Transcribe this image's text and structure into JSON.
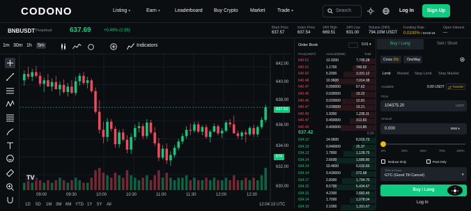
{
  "header": {
    "logo": "CODONO",
    "nav": [
      {
        "label": "Listing",
        "dropdown": true
      },
      {
        "label": "Earn",
        "dropdown": true
      },
      {
        "label": "Leaderboard",
        "dropdown": false
      },
      {
        "label": "Buy Crypto",
        "dropdown": false
      },
      {
        "label": "Market",
        "dropdown": false
      },
      {
        "label": "Trade",
        "dropdown": true
      }
    ],
    "search_placeholder": "Search",
    "login": "Log In",
    "signup": "Sign Up"
  },
  "ticker": {
    "symbol": "BNBUSDT",
    "type": "Perpetual",
    "price": "637.69",
    "change": "+0.40% (2.55)",
    "stats": [
      {
        "label": "Mark Price",
        "value": "637.57"
      },
      {
        "label": "Index Price",
        "value": "637.54"
      },
      {
        "label": "24H High",
        "value": "669.51"
      },
      {
        "label": "24H Low",
        "value": "631.00"
      },
      {
        "label": "Volume (24H)",
        "value": "794.10M USDT"
      },
      {
        "label": "Funding Rate",
        "value": "0.0100%",
        "extra": "/ 04:02:18"
      },
      {
        "label": "Open Interest",
        "value": "---"
      }
    ]
  },
  "chart_toolbar": {
    "timeframes": [
      "1m",
      "30m",
      "1h",
      "5m"
    ],
    "active_timeframe": "5m",
    "indicators": "Indicators"
  },
  "chart": {
    "price_labels": [
      "642.00",
      "640.00",
      "638.00",
      "636.00",
      "634.00",
      "632.00",
      "630.00"
    ],
    "time_labels": [
      "09:00",
      "09:30",
      "10:00",
      "10:30",
      "11:00",
      "11:30",
      "12:00",
      "12:30"
    ],
    "last_price_tag": "637.53",
    "volume_tag": "874",
    "ranges": [
      "1D",
      "5D",
      "1M",
      "3M",
      "6M",
      "YTD",
      "1Y",
      "5Y",
      "All"
    ],
    "clock": "12:04:13 UTC",
    "watermark": "TV"
  },
  "chart_data": {
    "type": "candlestick",
    "ylim": [
      630,
      643
    ],
    "candles": [
      [
        640.5,
        641.6,
        639.9,
        641.2
      ],
      [
        641.2,
        642.0,
        640.6,
        640.9
      ],
      [
        640.9,
        641.8,
        640.4,
        641.4
      ],
      [
        641.4,
        642.1,
        640.8,
        641.0
      ],
      [
        641.0,
        641.4,
        639.8,
        640.1
      ],
      [
        640.1,
        640.8,
        639.2,
        640.5
      ],
      [
        640.5,
        641.2,
        639.9,
        639.8
      ],
      [
        639.8,
        640.7,
        639.3,
        640.3
      ],
      [
        640.3,
        641.0,
        639.6,
        639.5
      ],
      [
        639.5,
        640.4,
        638.8,
        640.0
      ],
      [
        640.0,
        640.6,
        639.0,
        639.2
      ],
      [
        639.2,
        640.2,
        638.7,
        639.8
      ],
      [
        639.8,
        640.5,
        639.0,
        639.1
      ],
      [
        639.1,
        640.9,
        638.8,
        640.4
      ],
      [
        640.4,
        641.3,
        639.9,
        641.0
      ],
      [
        641.0,
        641.4,
        640.0,
        640.2
      ],
      [
        640.2,
        640.9,
        639.6,
        640.5
      ],
      [
        640.5,
        640.7,
        639.1,
        639.3
      ],
      [
        639.3,
        639.7,
        636.8,
        637.0
      ],
      [
        637.0,
        638.3,
        634.6,
        635.0
      ],
      [
        635.0,
        635.9,
        633.5,
        634.2
      ],
      [
        634.2,
        636.3,
        633.7,
        635.9
      ],
      [
        635.9,
        636.2,
        634.8,
        635.1
      ],
      [
        635.1,
        635.4,
        633.0,
        633.4
      ],
      [
        633.4,
        635.0,
        633.0,
        634.7
      ],
      [
        634.7,
        635.1,
        633.7,
        633.9
      ],
      [
        633.9,
        634.4,
        632.4,
        632.8
      ],
      [
        632.8,
        634.6,
        632.3,
        634.2
      ],
      [
        634.2,
        635.6,
        633.8,
        635.2
      ],
      [
        635.2,
        635.9,
        634.7,
        635.4
      ],
      [
        635.4,
        635.7,
        634.0,
        634.3
      ],
      [
        634.3,
        636.2,
        634.0,
        635.8
      ],
      [
        635.8,
        636.1,
        634.5,
        634.7
      ],
      [
        634.7,
        635.3,
        633.2,
        633.5
      ],
      [
        633.5,
        634.1,
        631.5,
        631.9
      ],
      [
        631.9,
        633.3,
        631.7,
        632.9
      ],
      [
        632.9,
        633.5,
        631.2,
        631.6
      ],
      [
        631.6,
        632.6,
        631.0,
        632.2
      ],
      [
        632.2,
        633.3,
        631.9,
        633.0
      ],
      [
        633.0,
        634.0,
        632.7,
        633.7
      ],
      [
        633.7,
        634.6,
        633.4,
        634.3
      ],
      [
        634.3,
        635.4,
        634.0,
        635.0
      ],
      [
        635.0,
        635.7,
        634.4,
        634.9
      ],
      [
        634.9,
        635.9,
        634.7,
        635.6
      ],
      [
        635.6,
        635.9,
        634.6,
        634.8
      ],
      [
        634.8,
        635.5,
        634.4,
        635.3
      ],
      [
        635.3,
        635.6,
        634.0,
        634.2
      ],
      [
        634.2,
        635.0,
        633.6,
        634.8
      ],
      [
        634.8,
        635.7,
        634.7,
        635.4
      ],
      [
        635.4,
        635.6,
        634.4,
        634.6
      ],
      [
        634.6,
        635.2,
        634.1,
        634.9
      ],
      [
        634.9,
        636.0,
        634.7,
        635.8
      ],
      [
        635.8,
        636.2,
        635.3,
        635.6
      ],
      [
        635.6,
        636.6,
        634.8,
        634.6
      ],
      [
        634.6,
        634.9,
        634.0,
        634.3
      ],
      [
        634.3,
        634.9,
        633.9,
        634.7
      ],
      [
        634.7,
        635.0,
        633.6,
        634.5
      ],
      [
        634.5,
        635.4,
        634.3,
        635.2
      ],
      [
        635.2,
        635.6,
        634.2,
        634.5
      ],
      [
        634.5,
        635.5,
        634.2,
        635.3
      ],
      [
        635.3,
        636.4,
        635.1,
        636.1
      ],
      [
        636.1,
        637.8,
        635.8,
        637.5
      ]
    ],
    "volumes": [
      3,
      4,
      3,
      5,
      4,
      3,
      4,
      3,
      4,
      5,
      4,
      3,
      4,
      5,
      4,
      3,
      3,
      5,
      8,
      9,
      7,
      6,
      5,
      7,
      6,
      5,
      8,
      6,
      5,
      4,
      5,
      6,
      4,
      6,
      8,
      5,
      7,
      5,
      4,
      5,
      5,
      6,
      4,
      5,
      4,
      4,
      5,
      4,
      5,
      4,
      4,
      5,
      4,
      6,
      4,
      4,
      5,
      4,
      5,
      4,
      6,
      9
    ]
  },
  "orderbook": {
    "title": "Order Book",
    "step": "0.01",
    "headers": [
      "Price(USDT)",
      "Amount(BNB)",
      "Total"
    ],
    "asks": [
      [
        "640.61",
        "12.9200",
        "7,705.28"
      ],
      [
        "640.61",
        "1.1700",
        "749.52"
      ],
      [
        "640.60",
        "5.2000",
        "3,331.12"
      ],
      [
        "640.48",
        "10.9600",
        "7,014.38"
      ],
      [
        "640.47",
        "0.090000",
        "57.62"
      ],
      [
        "640.46",
        "0.030000",
        "19.22"
      ],
      [
        "640.45",
        "0.020000",
        "12.81"
      ],
      [
        "640.47",
        "0.030000",
        "19.21"
      ],
      [
        "640.45",
        "1.9300",
        "1,236.11"
      ],
      [
        "640.47",
        "0.490000",
        "313.83"
      ],
      [
        "640.49",
        "0.490000",
        "313.85"
      ]
    ],
    "mid_price": "637.42",
    "mid_sub": "0.16",
    "bids": [
      [
        "634.12",
        "14.0600",
        "8,915.73"
      ],
      [
        "634.13",
        "0.040000",
        "25.37"
      ],
      [
        "634.13",
        "1.7800",
        "1,128.75"
      ],
      [
        "634.14",
        "2.6600",
        "1,686.80"
      ],
      [
        "634.14",
        "10.4600",
        "6,632.60"
      ],
      [
        "634.14",
        "0.430000",
        "272.68"
      ],
      [
        "634.17",
        "2.8300",
        "1,794.70"
      ],
      [
        "634.15",
        "8.5700",
        "5,434.67"
      ],
      [
        "634.15",
        "4.2300",
        "2,682.45"
      ],
      [
        "634.14",
        "1.7000",
        "1,078.04"
      ],
      [
        "634.13",
        "2.1000",
        "1,331.67"
      ]
    ]
  },
  "trade": {
    "tabs": [
      "Buy / Long",
      "Sell / Short"
    ],
    "margin_mode": "Cross",
    "leverage": "20x",
    "position_mode": "OneWay",
    "order_types": [
      "Limit",
      "Market",
      "Stop Limit",
      "Stop Market"
    ],
    "available_label": "Available",
    "available_value": "0.00 USDT",
    "transfer": "Transfer",
    "price_label": "Price",
    "price_value": "104375.20",
    "price_unit": "USDT",
    "amount_label": "Amount",
    "amount_value": "0.000",
    "amount_unit": "BNB",
    "slider_marks": [
      "0%",
      "25%",
      "50%",
      "75%",
      "100%"
    ],
    "slider_value": 0,
    "reduce_only": "Reduce Only",
    "post_only": "Post Only",
    "tif_label": "Time in Force",
    "tif_value": "GTC (Good Till Cancel)",
    "submit": "Buy / Long",
    "login_link": "Log In"
  },
  "colors": {
    "up": "#0ecb81",
    "down": "#f6465d",
    "bg": "#0b0e11",
    "accent": "#f0b90b"
  }
}
